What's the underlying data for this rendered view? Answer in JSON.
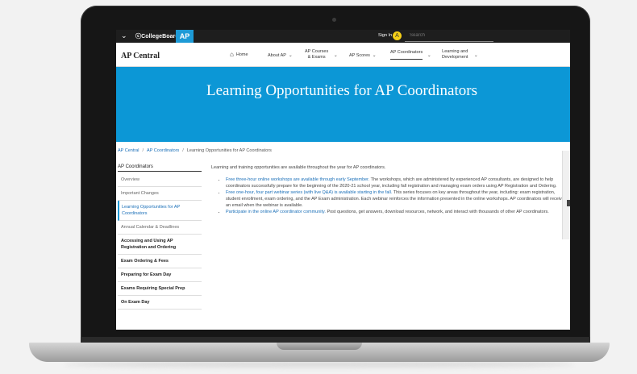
{
  "topbar": {
    "brand": "CollegeBoard",
    "ap_label": "AP",
    "signin": "Sign In",
    "avatar_letter": "A",
    "search_placeholder": "Search"
  },
  "nav": {
    "site_title": "AP Central",
    "home": "Home",
    "about": "About AP",
    "courses_line1": "AP Courses",
    "courses_line2": "& Exams",
    "scores": "AP Scores",
    "coordinators": "AP Coordinators",
    "learning_line1": "Learning and",
    "learning_line2": "Development"
  },
  "hero": {
    "title": "Learning Opportunities for AP Coordinators"
  },
  "breadcrumb": {
    "item1": "AP Central",
    "item2": "AP Coordinators",
    "item3": "Learning Opportunities for AP Coordinators"
  },
  "sidebar": {
    "heading": "AP Coordinators",
    "items": [
      {
        "label": "Overview"
      },
      {
        "label": "Important Changes"
      },
      {
        "label": "Learning Opportunities for AP Coordinators"
      },
      {
        "label": "Annual Calendar & Deadlines"
      },
      {
        "label": "Accessing and Using AP Registration and Ordering"
      },
      {
        "label": "Exam Ordering & Fees"
      },
      {
        "label": "Preparing for Exam Day"
      },
      {
        "label": "Exams Requiring Special Prep"
      },
      {
        "label": "On Exam Day"
      }
    ]
  },
  "main": {
    "intro": "Learning and training opportunities are available throughout the year for AP coordinators.",
    "bullets": [
      {
        "link": "Free three-hour online workshops are available through early September.",
        "text": " The workshops, which are administered by experienced AP consultants, are designed to help coordinators successfully prepare for the beginning of the 2020-21 school year, including fall registration and managing exam orders using AP Registration and Ordering."
      },
      {
        "link": "Free one-hour, four part webinar series (with live Q&A) is available starting in the fall.",
        "text": " This series focuses on key areas throughout the year, including: exam registration, student enrollment, exam ordering, and the AP Exam administration. Each webinar reinforces the information presented in the online workshops. AP coordinators will receive an email when the webinar is available."
      },
      {
        "link": "Participate in the online AP coordinator community.",
        "text": " Post questions, get answers, download resources, network, and interact with thousands of other AP coordinators."
      }
    ]
  },
  "colors": {
    "hero_bg": "#0c97d6",
    "link": "#1a6fb8",
    "topbar_bg": "#1e1e1e",
    "avatar": "#f6d017"
  }
}
